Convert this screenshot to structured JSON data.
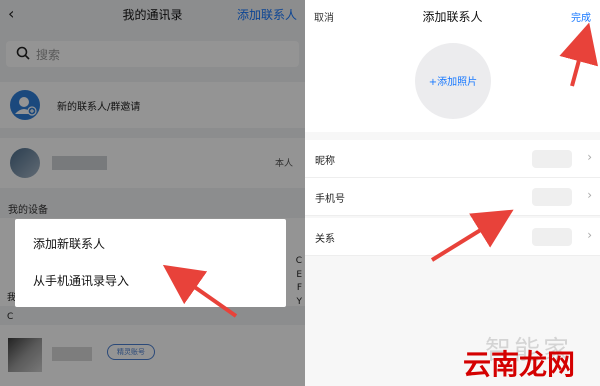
{
  "left": {
    "back_icon": "chevron-left-icon",
    "title": "我的通讯录",
    "add_contact_link": "添加联系人",
    "search_placeholder": "搜索",
    "new_contacts_label": "新的联系人/群邀请",
    "self_tag": "本人",
    "section_my_devices": "我的设备",
    "index_letters_right": [
      "C",
      "E",
      "F",
      "Y"
    ],
    "index_letters_left": [
      "我",
      "C"
    ],
    "device_badge": "精灵账号"
  },
  "popup": {
    "item_add_new": "添加新联系人",
    "item_import": "从手机通讯录导入"
  },
  "right": {
    "cancel": "取消",
    "title": "添加联系人",
    "done": "完成",
    "add_photo": "+添加照片",
    "fields": [
      {
        "label": "昵称"
      },
      {
        "label": "手机号"
      },
      {
        "label": "关系"
      }
    ]
  },
  "watermark": {
    "text_gray": "智能家",
    "text_red": "云南龙网"
  },
  "colors": {
    "accent": "#1677ff",
    "arrow": "#e8423a",
    "overlay": "#000000"
  }
}
